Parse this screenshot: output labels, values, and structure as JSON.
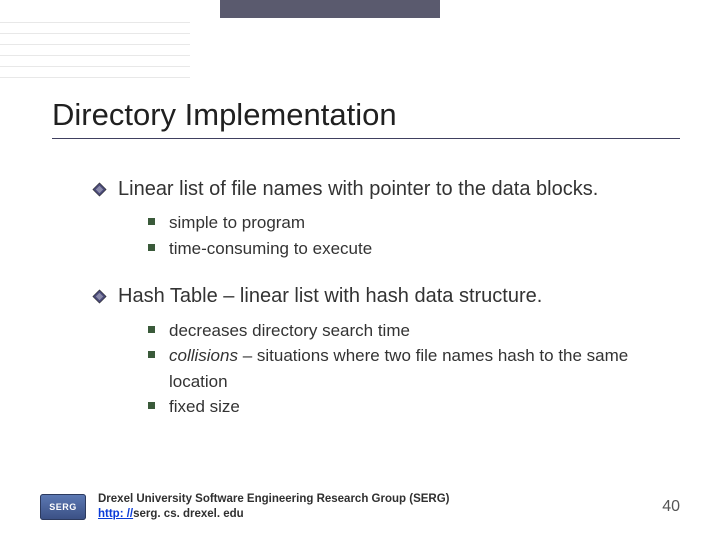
{
  "title": "Directory Implementation",
  "bullets": [
    {
      "text": "Linear list of file names with pointer to the data blocks.",
      "subs": [
        {
          "text": "simple to program"
        },
        {
          "text": "time-consuming to execute"
        }
      ]
    },
    {
      "text": "Hash Table – linear list with hash data structure.",
      "subs": [
        {
          "text": "decreases directory search time"
        },
        {
          "italic": "collisions",
          "rest": " – situations where two file names hash to the same location"
        },
        {
          "text": "fixed size"
        }
      ]
    }
  ],
  "footer": {
    "logo_text": "SERG",
    "line1": "Drexel University Software Engineering Research Group (SERG)",
    "url_proto": "http: //",
    "url_rest": "serg. cs. drexel. edu"
  },
  "page_number": "40"
}
